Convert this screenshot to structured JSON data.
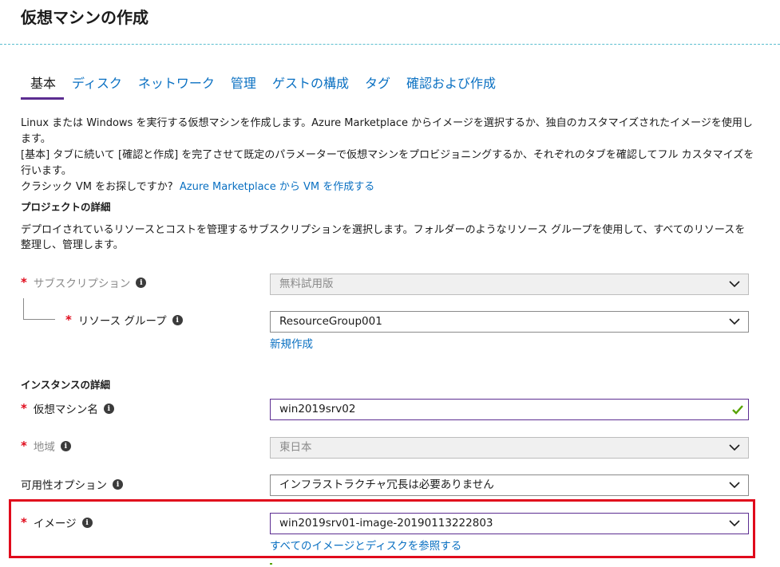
{
  "page": {
    "title": "仮想マシンの作成"
  },
  "tabs": [
    {
      "label": "基本",
      "active": true
    },
    {
      "label": "ディスク"
    },
    {
      "label": "ネットワーク"
    },
    {
      "label": "管理"
    },
    {
      "label": "ゲストの構成"
    },
    {
      "label": "タグ"
    },
    {
      "label": "確認および作成"
    }
  ],
  "intro": {
    "line1": "Linux または Windows を実行する仮想マシンを作成します。Azure Marketplace からイメージを選択するか、独自のカスタマイズされたイメージを使用します。",
    "line2": "[基本] タブに続いて [確認と作成] を完了させて既定のパラメーターで仮想マシンをプロビジョニングするか、それぞれのタブを確認してフル カスタマイズを行います。",
    "line3_prefix": "クラシック VM をお探しですか?",
    "line3_link": "Azure Marketplace から VM を作成する"
  },
  "project": {
    "title": "プロジェクトの詳細",
    "description": "デプロイされているリソースとコストを管理するサブスクリプションを選択します。フォルダーのようなリソース グループを使用して、すべてのリソースを整理し、管理します。",
    "subscription": {
      "label": "サブスクリプション",
      "value": "無料試用版"
    },
    "resource_group": {
      "label": "リソース グループ",
      "value": "ResourceGroup001",
      "new_link": "新規作成"
    }
  },
  "instance": {
    "title": "インスタンスの詳細",
    "vm_name": {
      "label": "仮想マシン名",
      "value": "win2019srv02"
    },
    "region": {
      "label": "地域",
      "value": "東日本"
    },
    "availability": {
      "label": "可用性オプション",
      "value": "インフラストラクチャ冗長は必要ありません"
    },
    "image": {
      "label": "イメージ",
      "value": "win2019srv01-image-20190113222803",
      "browse_link": "すべてのイメージとディスクを参照する"
    }
  },
  "colors": {
    "accent": "#5c2d91",
    "link": "#0a70c2",
    "required": "#e00b1c",
    "highlight": "#e00b1c",
    "valid": "#57a300"
  },
  "icons": {
    "info": "info-icon",
    "dropdown": "chevron-down-icon",
    "valid": "checkmark-icon"
  }
}
